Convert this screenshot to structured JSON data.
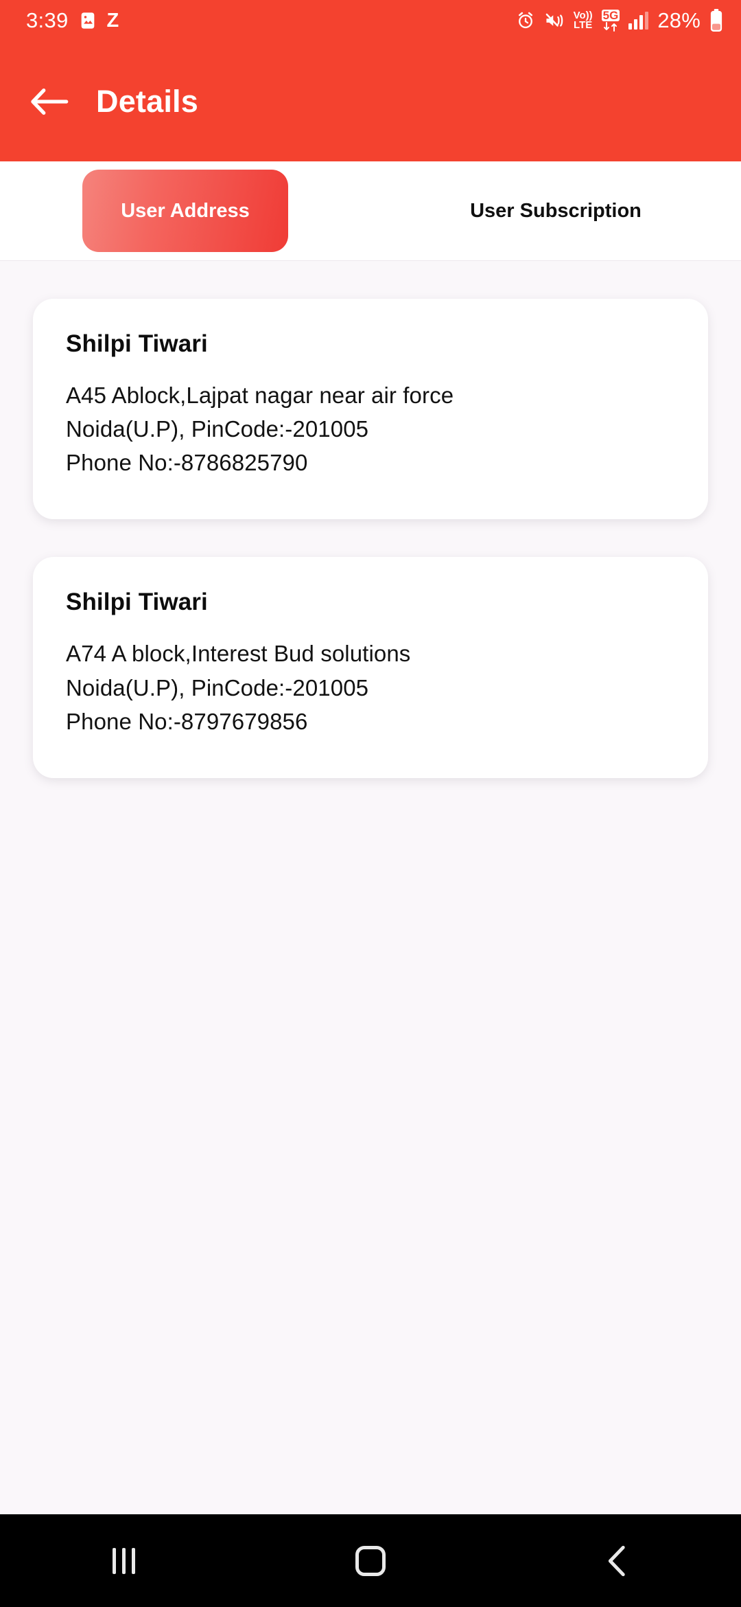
{
  "status_bar": {
    "time": "3:39",
    "left_icons": [
      "image-icon",
      "z-icon"
    ],
    "z_label": "Z",
    "volte_top": "Vo))",
    "volte_bottom": "LTE",
    "network_label": "5G",
    "battery_percent": "28%",
    "right_icons": [
      "alarm-icon",
      "mute-vibrate-icon",
      "volte-icon",
      "5g-data-icon",
      "signal-icon",
      "battery-icon"
    ]
  },
  "header": {
    "title": "Details",
    "back_icon": "back-arrow-icon",
    "bg_color": "#F4422F"
  },
  "tabs": {
    "active_index": 0,
    "items": [
      {
        "label": "User Address"
      },
      {
        "label": "User Subscription"
      }
    ]
  },
  "addresses": [
    {
      "name": "Shilpi Tiwari",
      "line1": "A45 Ablock,Lajpat nagar near air force",
      "line2": "Noida(U.P), PinCode:-201005",
      "line3": "Phone No:-8786825790"
    },
    {
      "name": "Shilpi Tiwari",
      "line1": "A74 A block,Interest Bud solutions",
      "line2": "Noida(U.P), PinCode:-201005",
      "line3": "Phone No:-8797679856"
    }
  ],
  "nav_bar": {
    "recents_icon": "recents-icon",
    "home_icon": "home-icon",
    "back_icon": "back-chevron-icon"
  }
}
